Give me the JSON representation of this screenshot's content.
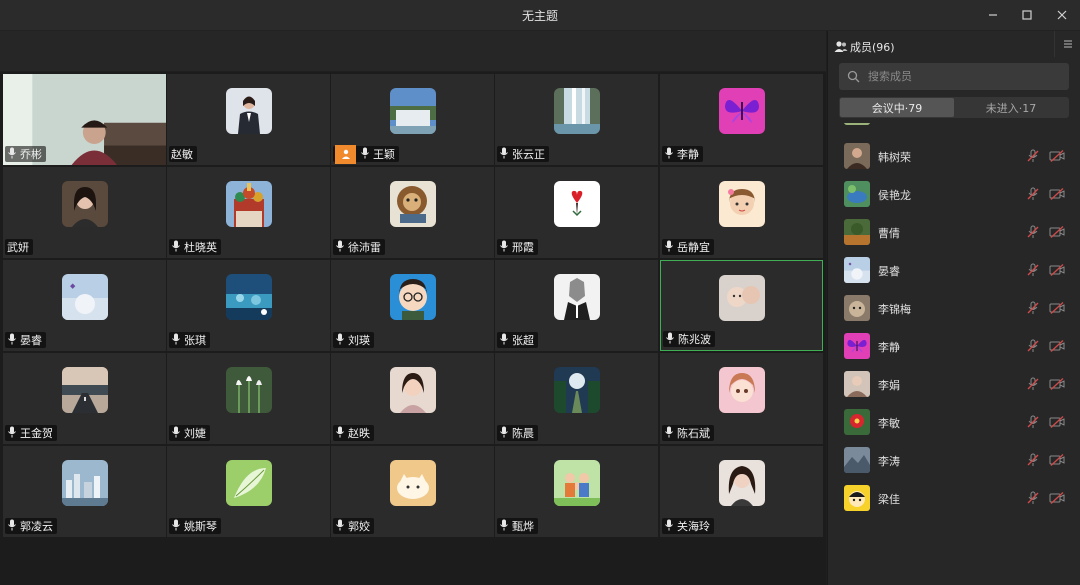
{
  "window": {
    "title": "无主题"
  },
  "grid": {
    "tiles": [
      {
        "name": "乔彬",
        "avatar": "video-feed",
        "mic": true
      },
      {
        "name": "赵敏",
        "avatar": "person-suit",
        "mic": false
      },
      {
        "name": "王颖",
        "avatar": "waterfall-landscape",
        "mic": true,
        "host_badge": true
      },
      {
        "name": "张云正",
        "avatar": "waterfall",
        "mic": true
      },
      {
        "name": "李静",
        "avatar": "butterfly",
        "mic": true
      },
      {
        "name": "武妍",
        "avatar": "woman-portrait",
        "mic": false
      },
      {
        "name": "杜晓英",
        "avatar": "castle",
        "mic": true
      },
      {
        "name": "徐沛雷",
        "avatar": "lion-cartoon",
        "mic": true
      },
      {
        "name": "邢霞",
        "avatar": "heart-flower",
        "mic": true
      },
      {
        "name": "岳静宜",
        "avatar": "cartoon-girl",
        "mic": true
      },
      {
        "name": "晏睿",
        "avatar": "blue-sky-logo",
        "mic": true
      },
      {
        "name": "张琪",
        "avatar": "underwater",
        "mic": true
      },
      {
        "name": "刘瑛",
        "avatar": "cartoon-glasses",
        "mic": true
      },
      {
        "name": "张超",
        "avatar": "wolf-suit",
        "mic": true
      },
      {
        "name": "陈兆波",
        "avatar": "baby-photo",
        "mic": true,
        "active": true
      },
      {
        "name": "王金贺",
        "avatar": "road-sunset",
        "mic": true
      },
      {
        "name": "刘婕",
        "avatar": "tulips",
        "mic": true
      },
      {
        "name": "赵昳",
        "avatar": "woman-selfie",
        "mic": true
      },
      {
        "name": "陈晨",
        "avatar": "forest-road",
        "mic": true
      },
      {
        "name": "陈石斌",
        "avatar": "anime-girl",
        "mic": true
      },
      {
        "name": "郭凌云",
        "avatar": "city-skyline",
        "mic": true
      },
      {
        "name": "姚斯琴",
        "avatar": "green-leaf",
        "mic": true
      },
      {
        "name": "郭姣",
        "avatar": "cat-cartoon",
        "mic": true
      },
      {
        "name": "甄烨",
        "avatar": "family-cartoon",
        "mic": true
      },
      {
        "name": "关海玲",
        "avatar": "woman-hair",
        "mic": true
      }
    ]
  },
  "panel": {
    "title": "成员(96)",
    "search_placeholder": "搜索成员",
    "tabs": [
      {
        "label": "会议中·79",
        "active": true
      },
      {
        "label": "未进入·17",
        "active": false
      }
    ],
    "members": [
      {
        "name": "韩树荣",
        "avatar": "person-brown"
      },
      {
        "name": "侯艳龙",
        "avatar": "pond-green"
      },
      {
        "name": "曹倩",
        "avatar": "forest-orange"
      },
      {
        "name": "晏睿",
        "avatar": "blue-sky-logo"
      },
      {
        "name": "李锦梅",
        "avatar": "dog-photo"
      },
      {
        "name": "李静",
        "avatar": "butterfly"
      },
      {
        "name": "李娟",
        "avatar": "person-light"
      },
      {
        "name": "李敏",
        "avatar": "red-flower"
      },
      {
        "name": "李涛",
        "avatar": "landscape-gray"
      },
      {
        "name": "梁佳",
        "avatar": "yellow-cartoon"
      }
    ]
  },
  "colors": {
    "accent_active": "#3fae55",
    "host_badge": "#f08a2c"
  }
}
